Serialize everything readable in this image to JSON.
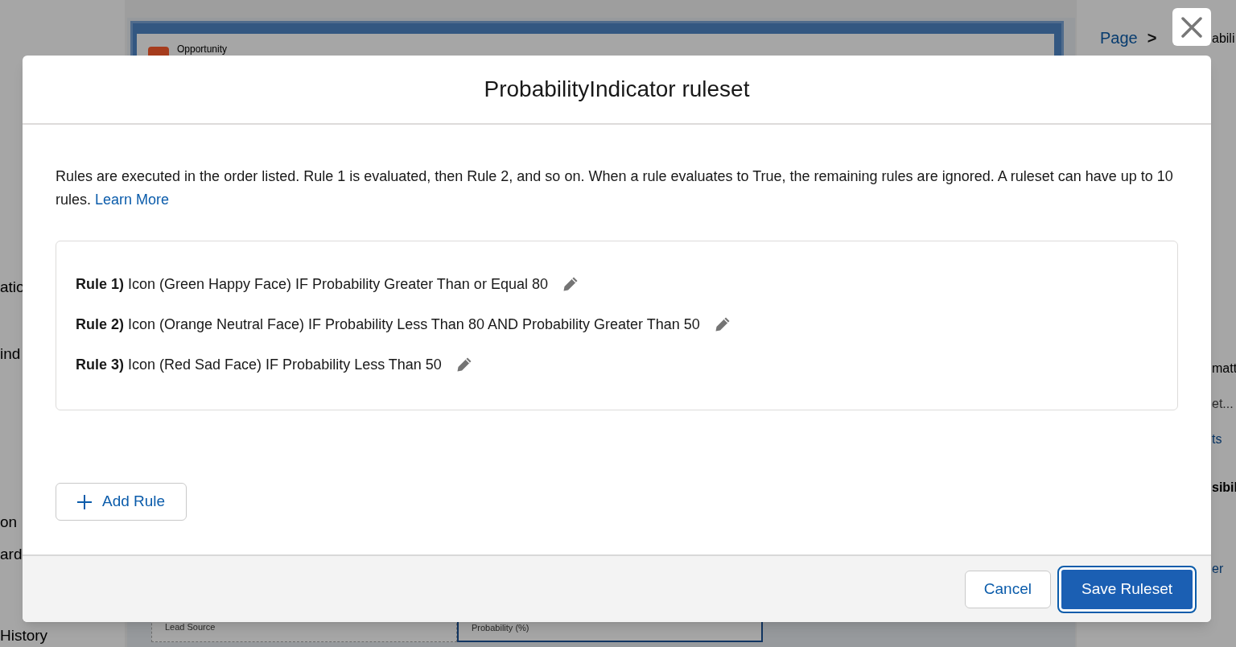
{
  "background": {
    "left_panel": {
      "items": [
        {
          "label": "atio"
        },
        {
          "label": "ind"
        },
        {
          "label": "on"
        },
        {
          "label": "ard"
        },
        {
          "label": "History"
        }
      ]
    },
    "canvas": {
      "record_label": "Opportunity",
      "fields": [
        {
          "label": "Lead Source",
          "selected": false
        },
        {
          "label": "Probability (%)",
          "selected": true
        }
      ]
    },
    "right_panel": {
      "breadcrumb": [
        "Page",
        ">",
        "abili"
      ],
      "items": [
        {
          "label": "matt",
          "kind": "text"
        },
        {
          "label": "et...",
          "kind": "field"
        },
        {
          "label": "ts",
          "kind": "link"
        },
        {
          "label": "sibil",
          "kind": "heading"
        },
        {
          "label": "er",
          "kind": "link"
        }
      ]
    }
  },
  "modal": {
    "title": "ProbabilityIndicator ruleset",
    "description": "Rules are executed in the order listed. Rule 1 is evaluated, then Rule 2, and so on. When a rule evaluates to True, the remaining rules are ignored. A ruleset can have up to 10 rules.",
    "learn_more": "Learn More",
    "rules": [
      {
        "number": "Rule 1)",
        "text": "Icon (Green Happy Face) IF Probability Greater Than or Equal 80"
      },
      {
        "number": "Rule 2)",
        "text": "Icon (Orange Neutral Face) IF Probability Less Than 80 AND Probability Greater Than 50"
      },
      {
        "number": "Rule 3)",
        "text": "Icon (Red Sad Face) IF Probability Less Than 50"
      }
    ],
    "add_rule": "Add Rule",
    "buttons": [
      {
        "label": "Cancel",
        "kind": "neutral"
      },
      {
        "label": "Save Ruleset",
        "kind": "brand"
      }
    ]
  }
}
